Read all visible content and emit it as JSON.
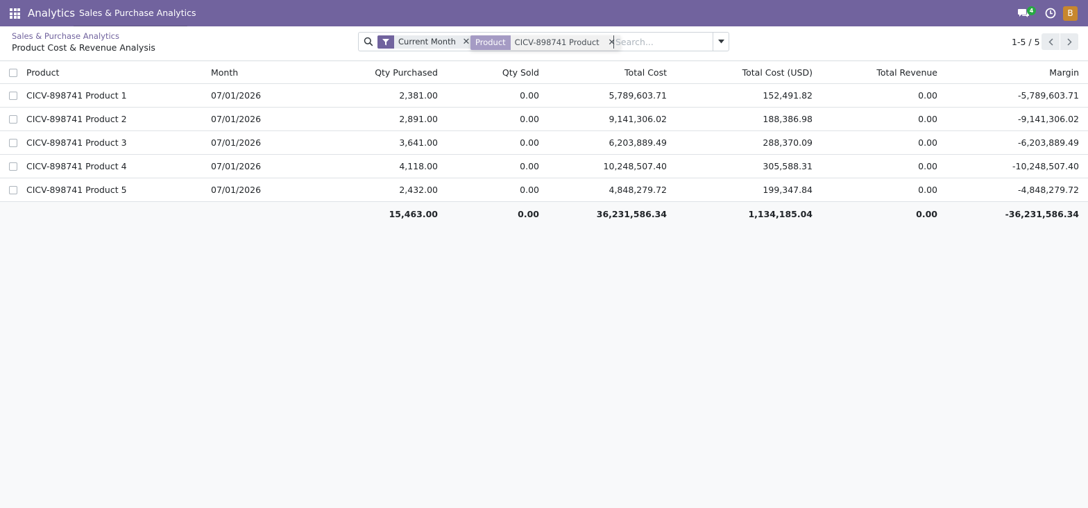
{
  "navbar": {
    "brand": "Analytics",
    "menu_title": "Sales & Purchase Analytics",
    "chat_count": "4",
    "avatar_initial": "B",
    "colors": {
      "bar": "#71639e",
      "badge": "#28a745",
      "avatar": "#c8872e"
    }
  },
  "breadcrumb": {
    "parent": "Sales & Purchase Analytics",
    "current": "Product Cost & Revenue Analysis"
  },
  "search": {
    "facets": [
      {
        "category_icon": "filter-icon",
        "value": "Current Month"
      },
      {
        "category": "Product",
        "value": "CICV-898741 Product"
      }
    ],
    "placeholder": "Search..."
  },
  "pager": {
    "value": "1-5 / 5"
  },
  "table": {
    "columns": [
      "Product",
      "Month",
      "Qty Purchased",
      "Qty Sold",
      "Total Cost",
      "Total Cost (USD)",
      "Total Revenue",
      "Margin"
    ],
    "rows": [
      {
        "product": "CICV-898741 Product 1",
        "month": "07/01/2026",
        "qty_purchased": "2,381.00",
        "qty_sold": "0.00",
        "total_cost": "5,789,603.71",
        "total_cost_usd": "152,491.82",
        "total_revenue": "0.00",
        "margin": "-5,789,603.71"
      },
      {
        "product": "CICV-898741 Product 2",
        "month": "07/01/2026",
        "qty_purchased": "2,891.00",
        "qty_sold": "0.00",
        "total_cost": "9,141,306.02",
        "total_cost_usd": "188,386.98",
        "total_revenue": "0.00",
        "margin": "-9,141,306.02"
      },
      {
        "product": "CICV-898741 Product 3",
        "month": "07/01/2026",
        "qty_purchased": "3,641.00",
        "qty_sold": "0.00",
        "total_cost": "6,203,889.49",
        "total_cost_usd": "288,370.09",
        "total_revenue": "0.00",
        "margin": "-6,203,889.49"
      },
      {
        "product": "CICV-898741 Product 4",
        "month": "07/01/2026",
        "qty_purchased": "4,118.00",
        "qty_sold": "0.00",
        "total_cost": "10,248,507.40",
        "total_cost_usd": "305,588.31",
        "total_revenue": "0.00",
        "margin": "-10,248,507.40"
      },
      {
        "product": "CICV-898741 Product 5",
        "month": "07/01/2026",
        "qty_purchased": "2,432.00",
        "qty_sold": "0.00",
        "total_cost": "4,848,279.72",
        "total_cost_usd": "199,347.84",
        "total_revenue": "0.00",
        "margin": "-4,848,279.72"
      }
    ],
    "totals": {
      "qty_purchased": "15,463.00",
      "qty_sold": "0.00",
      "total_cost": "36,231,586.34",
      "total_cost_usd": "1,134,185.04",
      "total_revenue": "0.00",
      "margin": "-36,231,586.34"
    }
  }
}
